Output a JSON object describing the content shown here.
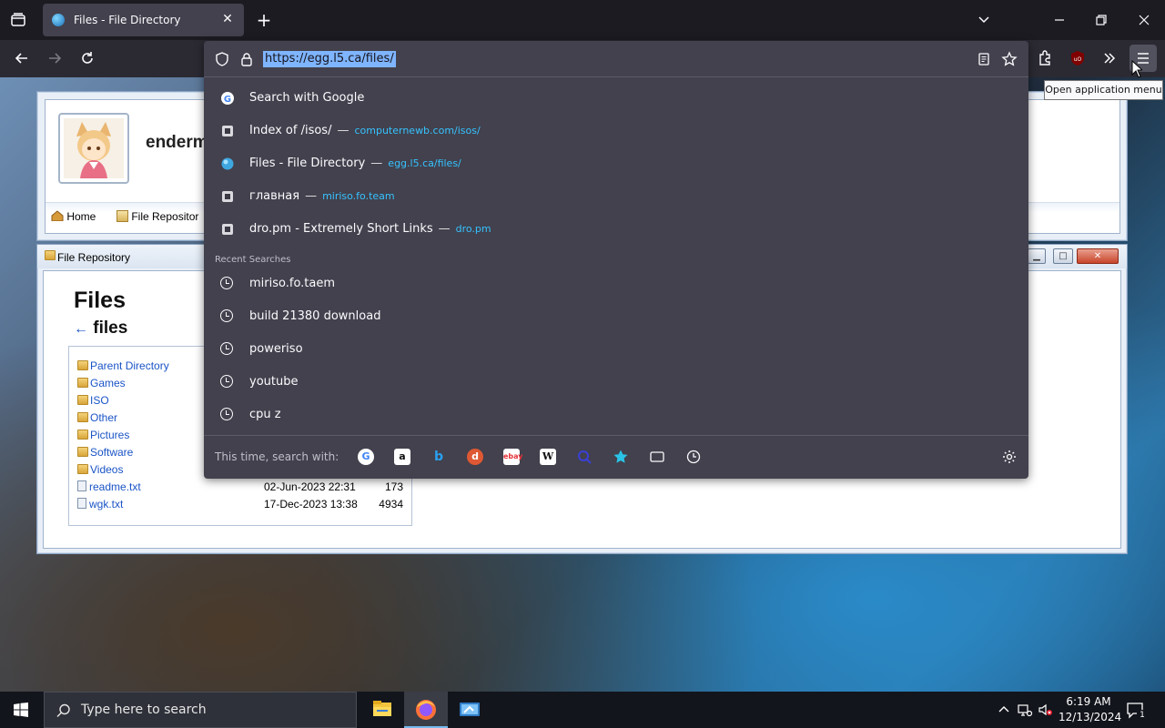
{
  "browser": {
    "tab_title": "Files - File Directory",
    "url": "https://egg.l5.ca/files/",
    "tooltip": "Open application menu",
    "icons": [
      "tabs-list-icon",
      "close-icon",
      "new-tab-icon",
      "chevron-down-icon",
      "minimize-icon",
      "restore-icon",
      "window-close-icon",
      "back-icon",
      "forward-icon",
      "reload-icon",
      "shield-icon",
      "lock-icon",
      "reader-view-icon",
      "bookmark-star-icon",
      "extensions-icon",
      "ublock-icon",
      "overflow-icon",
      "hamburger-menu-icon"
    ]
  },
  "suggestions": [
    {
      "title": "Search with Google",
      "url": "",
      "icon": "google-icon"
    },
    {
      "title": "Index of /isos/",
      "url": "computernewb.com/isos/",
      "icon": "site-icon"
    },
    {
      "title": "Files - File Directory",
      "url": "egg.l5.ca/files/",
      "icon": "globe-icon"
    },
    {
      "title": "главная",
      "url": "miriso.fo.team",
      "icon": "site-icon"
    },
    {
      "title": "dro.pm - Extremely Short Links",
      "url": "dro.pm",
      "icon": "site-icon"
    }
  ],
  "recent_label": "Recent Searches",
  "recent": [
    "miriso.fo.taem",
    "build 21380 download",
    "poweriso",
    "youtube",
    "cpu z"
  ],
  "footer": {
    "label": "This time, search with:",
    "engines": [
      "google",
      "amazon",
      "bing",
      "duckduckgo",
      "ebay",
      "wikipedia",
      "search",
      "bookmarks",
      "tabs",
      "history"
    ]
  },
  "page": {
    "site_name": "enderm",
    "nav": [
      "Home",
      "File Repositor"
    ],
    "window_title": "File Repository",
    "heading": "Files",
    "subheading": "files",
    "back_arrow": "←",
    "entries": [
      {
        "name": "Parent Directory",
        "type": "folder",
        "date": "",
        "size": ""
      },
      {
        "name": "Games",
        "type": "folder",
        "date": "",
        "size": ""
      },
      {
        "name": "ISO",
        "type": "folder",
        "date": "",
        "size": ""
      },
      {
        "name": "Other",
        "type": "folder",
        "date": "",
        "size": ""
      },
      {
        "name": "Pictures",
        "type": "folder",
        "date": "",
        "size": ""
      },
      {
        "name": "Software",
        "type": "folder",
        "date": "",
        "size": ""
      },
      {
        "name": "Videos",
        "type": "folder",
        "date": "",
        "size": ""
      },
      {
        "name": "readme.txt",
        "type": "file",
        "date": "02-Jun-2023 22:31",
        "size": "173"
      },
      {
        "name": "wgk.txt",
        "type": "file",
        "date": "17-Dec-2023 13:38",
        "size": "4934"
      }
    ]
  },
  "taskbar": {
    "search_placeholder": "Type here to search",
    "time": "6:19 AM",
    "date": "12/13/2024",
    "notification_count": "1"
  }
}
